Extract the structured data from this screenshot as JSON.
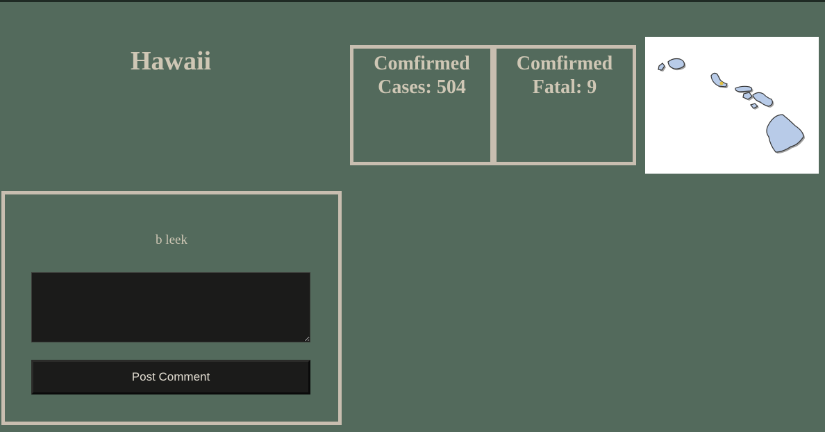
{
  "state": {
    "name": "Hawaii"
  },
  "stats": {
    "cases": {
      "line1": "Comfirmed",
      "line2": "Cases: 504"
    },
    "fatal": {
      "line1": "Comfirmed",
      "line2": "Fatal: 9"
    }
  },
  "map": {
    "icon": "hawaii-map-image",
    "island_fill": "#b8cbe8",
    "island_stroke": "#333333",
    "background": "#ffffff"
  },
  "comments": {
    "username": "b leek",
    "textarea_value": "",
    "post_label": "Post Comment"
  },
  "colors": {
    "page_background": "#536a5c",
    "border": "#c8beb0",
    "text": "#cfc7b5",
    "input_background": "#1b1b1a"
  }
}
